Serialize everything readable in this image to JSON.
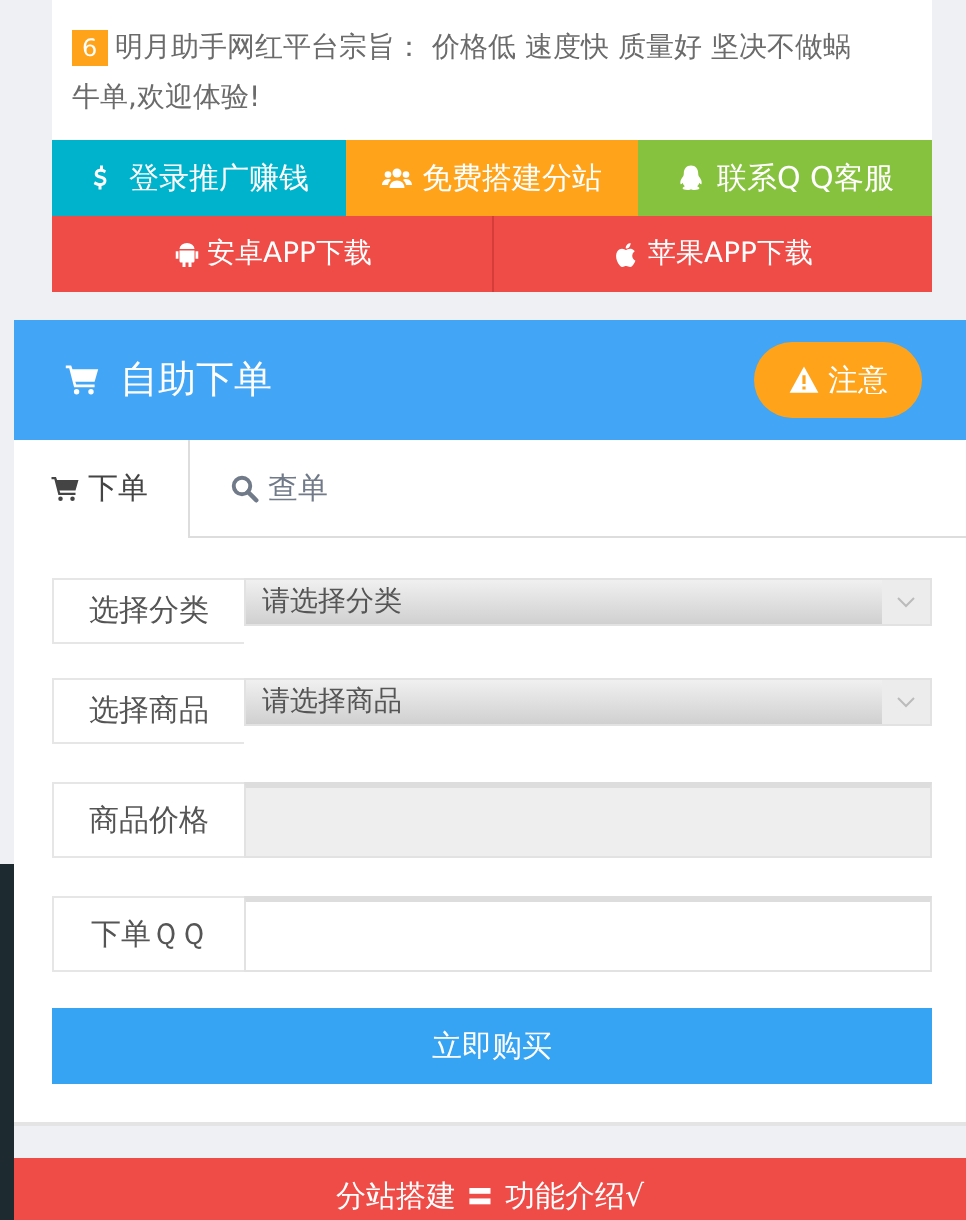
{
  "notice": {
    "badge": "6",
    "text": "明月助手网红平台宗旨： 价格低 速度快 质量好 坚决不做蜗牛单,欢迎体验!"
  },
  "quick_links": [
    {
      "label": "登录推广赚钱",
      "kind": "dollar",
      "color": "#00b3cc"
    },
    {
      "label": "免费搭建分站",
      "kind": "users",
      "color": "#ffa31a"
    },
    {
      "label": "联系Q Q客服",
      "kind": "qq",
      "color": "#86c23d"
    }
  ],
  "app_links": [
    {
      "label": "安卓APP下载",
      "kind": "android"
    },
    {
      "label": "苹果APP下载",
      "kind": "apple"
    }
  ],
  "order_panel": {
    "title": "自助下单",
    "notice_button": "注意",
    "tabs": [
      {
        "label": "下单",
        "kind": "cart",
        "selected": true
      },
      {
        "label": "查单",
        "kind": "search",
        "selected": false
      }
    ],
    "fields": [
      {
        "kind": "select",
        "label": "选择分类",
        "value": "请选择分类"
      },
      {
        "kind": "select",
        "label": "选择商品",
        "value": "请选择商品"
      },
      {
        "kind": "readonly",
        "label": "商品价格"
      },
      {
        "kind": "input",
        "label": "下单ＱＱ"
      }
    ],
    "submit": "立即购买"
  },
  "footer_bar": {
    "text": "分站搭建 〓 功能介绍√"
  }
}
